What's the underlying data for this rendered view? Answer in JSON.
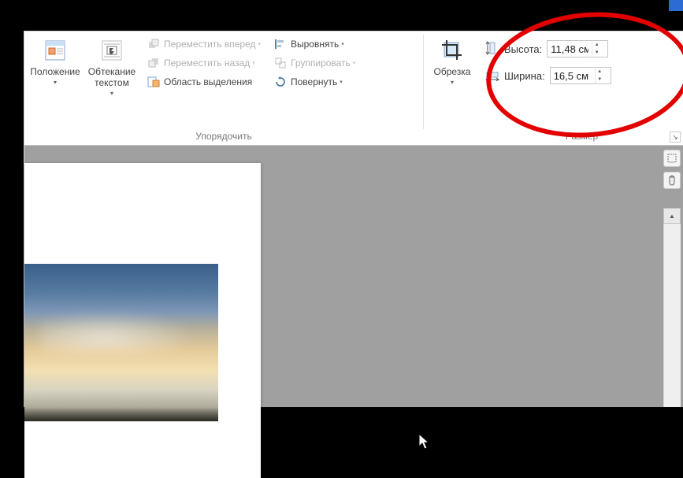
{
  "arrange": {
    "group_label": "Упорядочить",
    "position_label": "Положение",
    "wrap_label": "Обтекание текстом",
    "bring_forward": "Переместить вперед",
    "send_backward": "Переместить назад",
    "selection_pane": "Область выделения",
    "align": "Выровнять",
    "group": "Группировать",
    "rotate": "Повернуть"
  },
  "crop": {
    "group_label": "Обрезка",
    "crop_label": "Обрезка"
  },
  "size": {
    "group_label": "Размер",
    "height_label": "Высота:",
    "width_label": "Ширина:",
    "height_value": "11,48 см",
    "width_value": "16,5 см"
  }
}
